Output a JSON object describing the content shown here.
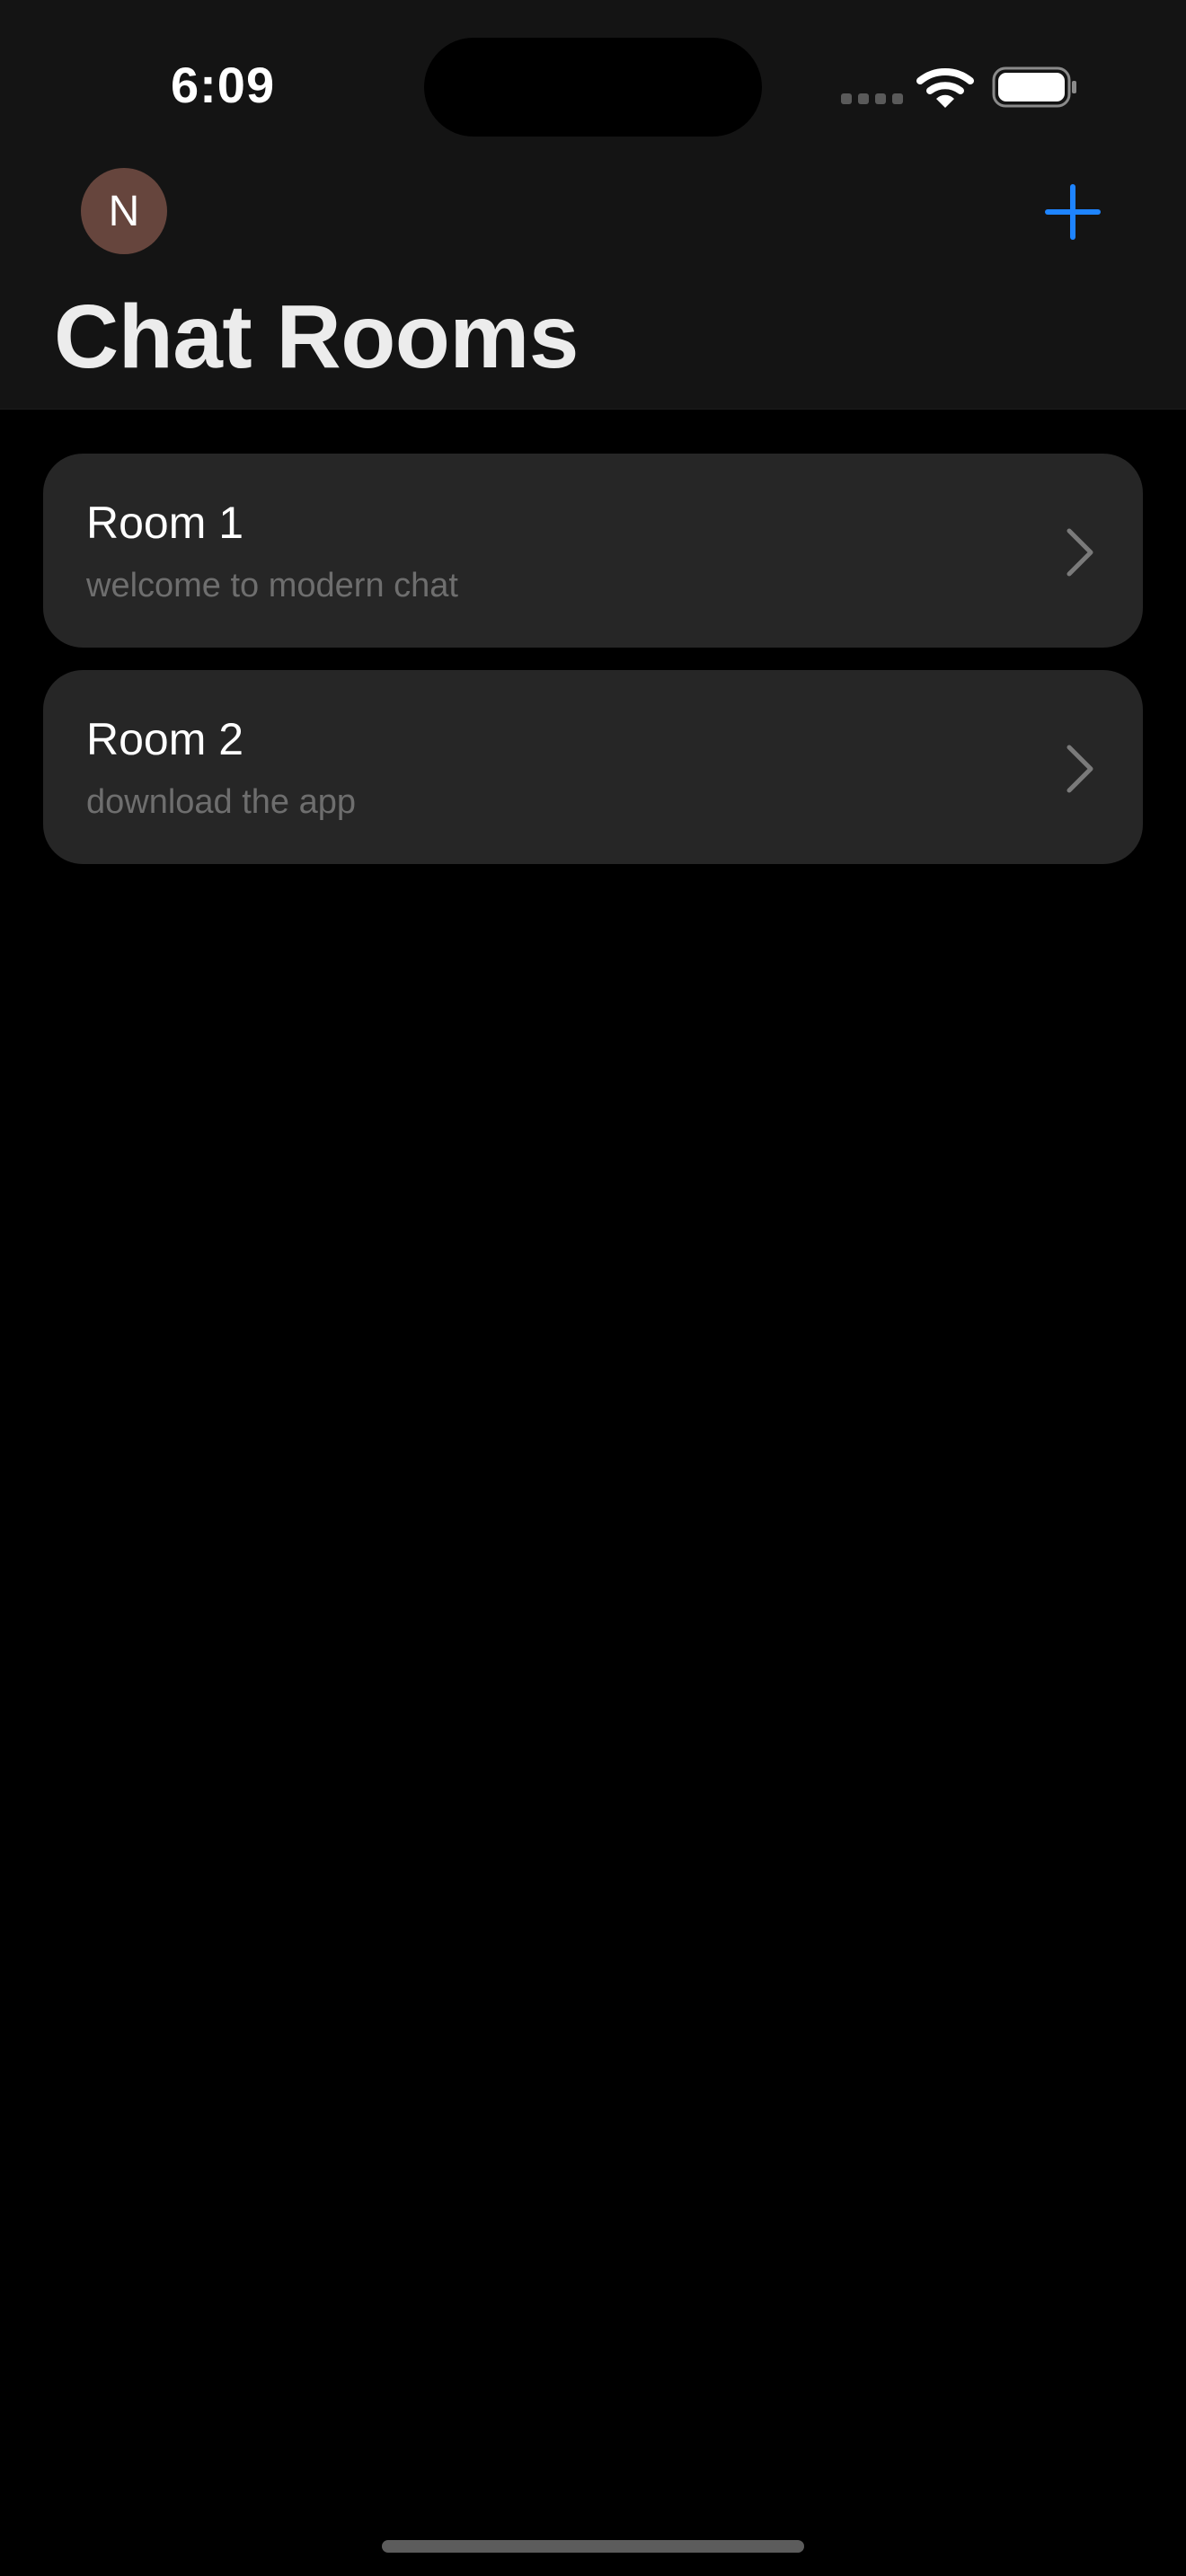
{
  "status_bar": {
    "time": "6:09"
  },
  "header": {
    "avatar_initial": "N",
    "title": "Chat Rooms",
    "add_icon": "plus-icon"
  },
  "rooms": [
    {
      "name": "Room 1",
      "subtitle": "welcome to modern chat"
    },
    {
      "name": "Room 2",
      "subtitle": "download the app"
    }
  ],
  "colors": {
    "accent": "#1e84ff",
    "background": "#000000",
    "header_background": "#141414",
    "card_background": "#262626",
    "avatar_background": "#66453d",
    "subtitle_text": "#6e6e6e"
  }
}
